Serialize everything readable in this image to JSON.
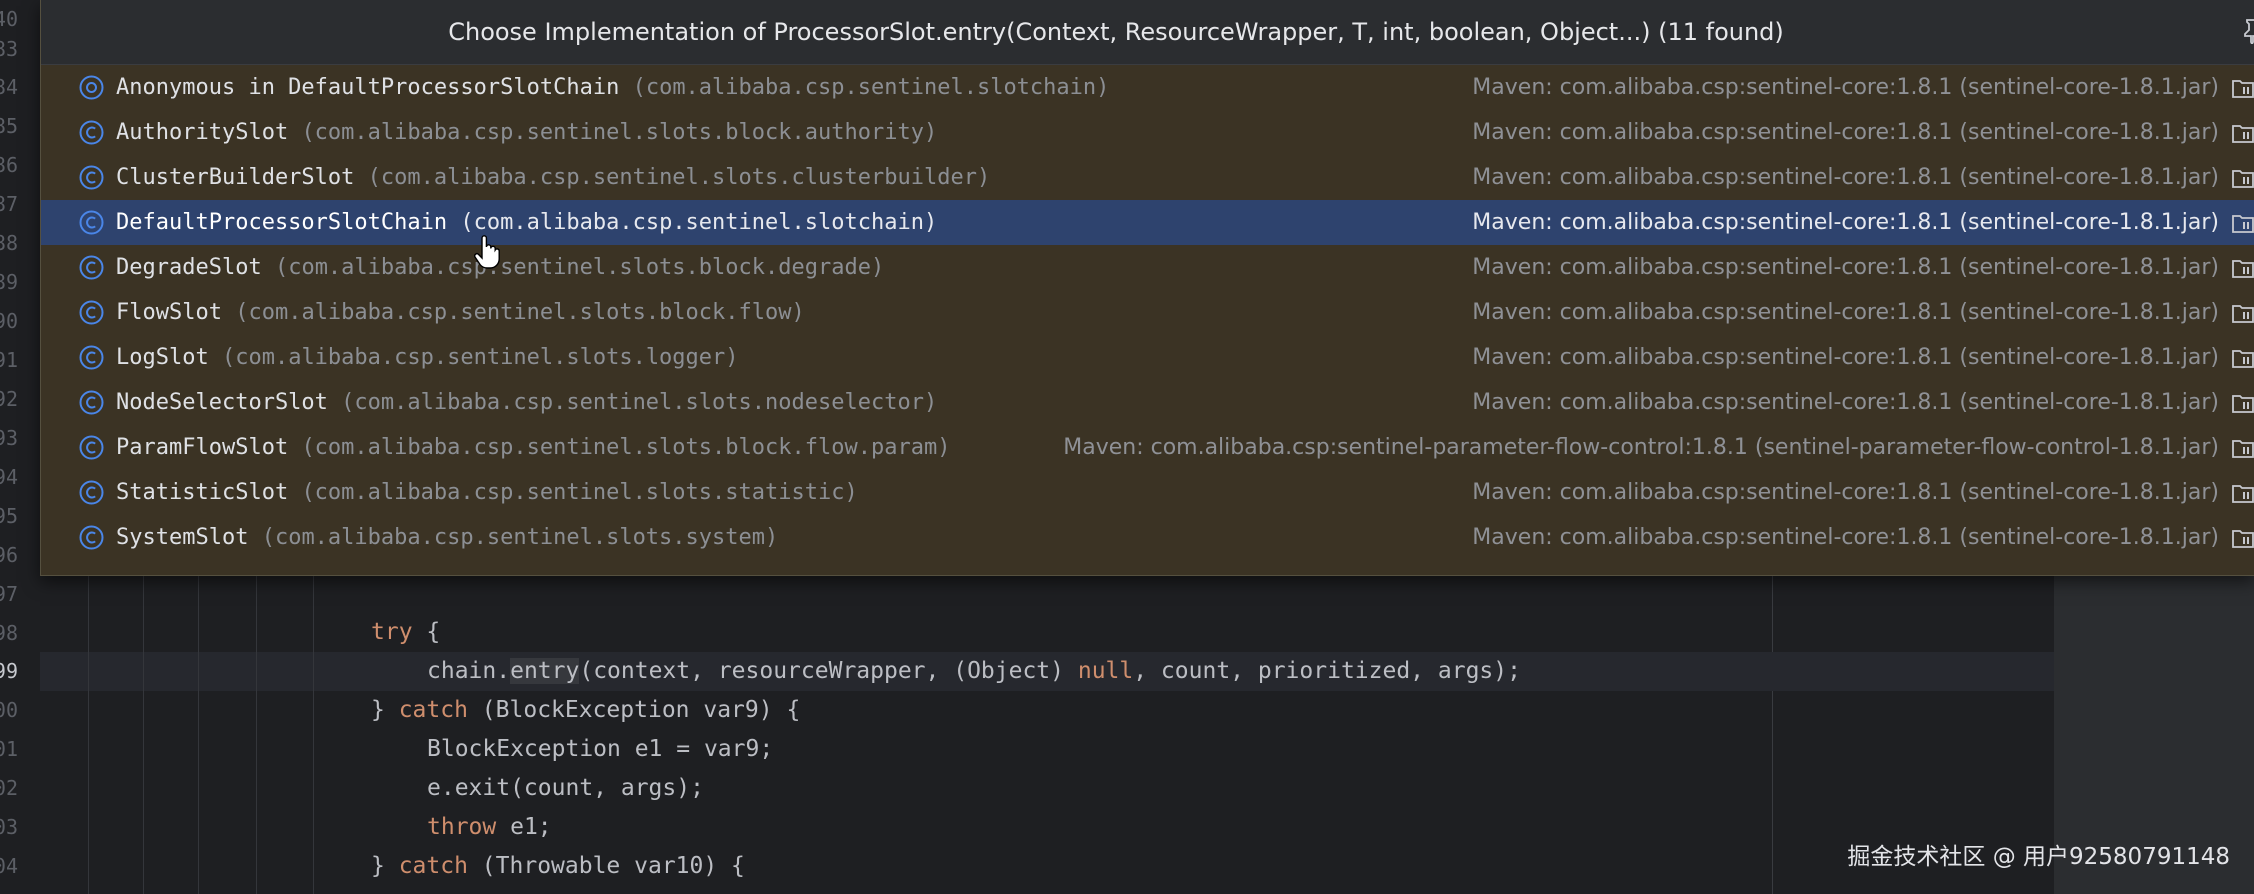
{
  "popup": {
    "title": "Choose Implementation of ProcessorSlot.entry(Context, ResourceWrapper, T, int, boolean, Object...) (11 found)",
    "selected_index": 3,
    "items": [
      {
        "name": "Anonymous in DefaultProcessorSlotChain",
        "package": "(com.alibaba.csp.sentinel.slotchain)",
        "library": "Maven: com.alibaba.csp:sentinel-core:1.8.1 (sentinel-core-1.8.1.jar)",
        "icon": "anonymous-class-icon"
      },
      {
        "name": "AuthoritySlot",
        "package": "(com.alibaba.csp.sentinel.slots.block.authority)",
        "library": "Maven: com.alibaba.csp:sentinel-core:1.8.1 (sentinel-core-1.8.1.jar)",
        "icon": "class-icon"
      },
      {
        "name": "ClusterBuilderSlot",
        "package": "(com.alibaba.csp.sentinel.slots.clusterbuilder)",
        "library": "Maven: com.alibaba.csp:sentinel-core:1.8.1 (sentinel-core-1.8.1.jar)",
        "icon": "class-icon"
      },
      {
        "name": "DefaultProcessorSlotChain",
        "package": "(com.alibaba.csp.sentinel.slotchain)",
        "library": "Maven: com.alibaba.csp:sentinel-core:1.8.1 (sentinel-core-1.8.1.jar)",
        "icon": "class-icon"
      },
      {
        "name": "DegradeSlot",
        "package": "(com.alibaba.csp.sentinel.slots.block.degrade)",
        "library": "Maven: com.alibaba.csp:sentinel-core:1.8.1 (sentinel-core-1.8.1.jar)",
        "icon": "class-icon"
      },
      {
        "name": "FlowSlot",
        "package": "(com.alibaba.csp.sentinel.slots.block.flow)",
        "library": "Maven: com.alibaba.csp:sentinel-core:1.8.1 (sentinel-core-1.8.1.jar)",
        "icon": "class-icon"
      },
      {
        "name": "LogSlot",
        "package": "(com.alibaba.csp.sentinel.slots.logger)",
        "library": "Maven: com.alibaba.csp:sentinel-core:1.8.1 (sentinel-core-1.8.1.jar)",
        "icon": "class-icon"
      },
      {
        "name": "NodeSelectorSlot",
        "package": "(com.alibaba.csp.sentinel.slots.nodeselector)",
        "library": "Maven: com.alibaba.csp:sentinel-core:1.8.1 (sentinel-core-1.8.1.jar)",
        "icon": "class-icon"
      },
      {
        "name": "ParamFlowSlot",
        "package": "(com.alibaba.csp.sentinel.slots.block.flow.param)",
        "library": "Maven: com.alibaba.csp:sentinel-parameter-flow-control:1.8.1 (sentinel-parameter-flow-control-1.8.1.jar)",
        "icon": "class-icon"
      },
      {
        "name": "StatisticSlot",
        "package": "(com.alibaba.csp.sentinel.slots.statistic)",
        "library": "Maven: com.alibaba.csp:sentinel-core:1.8.1 (sentinel-core-1.8.1.jar)",
        "icon": "class-icon"
      },
      {
        "name": "SystemSlot",
        "package": "(com.alibaba.csp.sentinel.slots.system)",
        "library": "Maven: com.alibaba.csp:sentinel-core:1.8.1 (sentinel-core-1.8.1.jar)",
        "icon": "class-icon"
      }
    ]
  },
  "editor": {
    "line_numbers": [
      "40",
      "83",
      "84",
      "85",
      "86",
      "87",
      "88",
      "89",
      "90",
      "91",
      "92",
      "93",
      "94",
      "95",
      "96",
      "97",
      "98",
      "99",
      "00",
      "01",
      "02",
      "03",
      "04"
    ],
    "active_line_index": 17,
    "code": {
      "line1_kw": "try",
      "line1_rest": " {",
      "line2_pre": "chain.",
      "line2_method": "entry",
      "line2_mid": "(context, resourceWrapper, (Object) ",
      "line2_null": "null",
      "line2_post": ", count, prioritized, args);",
      "line3_pre": "} ",
      "line3_kw": "catch",
      "line3_post": " (BlockException var9) {",
      "line4": "BlockException e1 = var9;",
      "line5": "e.exit(count, args);",
      "line6_kw": "throw",
      "line6_post": " e1;",
      "line7_pre": "} ",
      "line7_kw": "catch",
      "line7_post": " (Throwable var10) {"
    }
  },
  "watermark": "掘金技术社区 @ 用户92580791148",
  "colors": {
    "popup_bg": "#3b3324",
    "selection": "#2e436e",
    "keyword": "#cf8e6d",
    "icon_blue": "#4a86e8"
  }
}
